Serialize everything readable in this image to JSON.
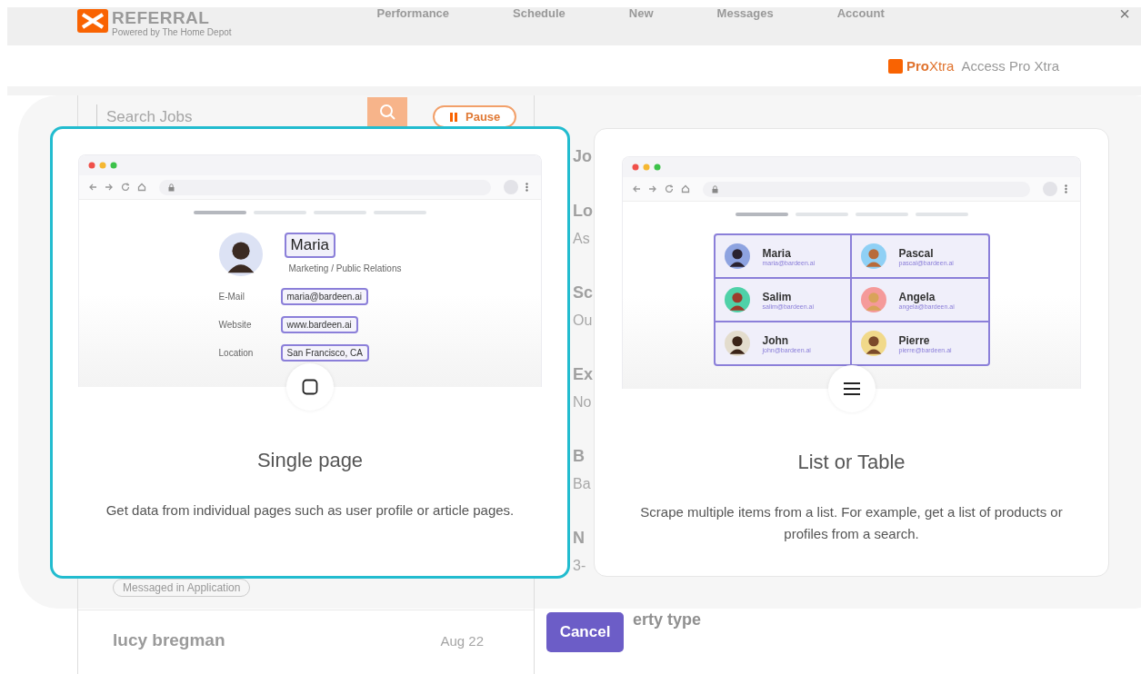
{
  "header": {
    "logo_text": "REFERRAL",
    "logo_tagline": "Powered by The Home Depot",
    "nav": [
      "Performance",
      "Schedule",
      "New",
      "Messages",
      "Account"
    ],
    "close": "×"
  },
  "pro_xtra": {
    "logo_pro": "Pro",
    "logo_xtra": "Xtra",
    "link": "Access Pro Xtra"
  },
  "jobs": {
    "search": {
      "placeholder": "Search Jobs"
    },
    "pause": "Pause",
    "tag": "Messaged in Application",
    "job": {
      "name": "lucy bregman",
      "date": "Aug 22"
    }
  },
  "details": [
    {
      "heading": "Jo"
    },
    {
      "heading": "Lo",
      "value": "As"
    },
    {
      "heading": "Sc",
      "value": "Ou"
    },
    {
      "heading": "Ex",
      "value": "No"
    },
    {
      "heading": "B",
      "value": "Ba"
    },
    {
      "heading": "N",
      "value": "3-"
    }
  ],
  "property_heading": "erty type",
  "modal": {
    "options": [
      {
        "kind": "single",
        "selected": true,
        "title": "Single page",
        "description": "Get data from individual pages such as user profile or article pages.",
        "profile": {
          "name": "Maria",
          "role": "Marketing / Public Relations",
          "fields": [
            {
              "label": "E-Mail",
              "value": "maria@bardeen.ai"
            },
            {
              "label": "Website",
              "value": "www.bardeen.ai"
            },
            {
              "label": "Location",
              "value": "San Francisco, CA"
            }
          ]
        }
      },
      {
        "kind": "list",
        "selected": false,
        "title": "List or Table",
        "description": "Scrape multiple items from a list. For example, get a list of products or profiles from a search.",
        "people": [
          {
            "name": "Maria",
            "email": "maria@bardeen.ai"
          },
          {
            "name": "Pascal",
            "email": "pascal@bardeen.ai"
          },
          {
            "name": "Salim",
            "email": "salim@bardeen.ai"
          },
          {
            "name": "Angela",
            "email": "angela@bardeen.ai"
          },
          {
            "name": "John",
            "email": "john@bardeen.ai"
          },
          {
            "name": "Pierre",
            "email": "pierre@bardeen.ai"
          }
        ]
      }
    ],
    "cancel": "Cancel"
  }
}
